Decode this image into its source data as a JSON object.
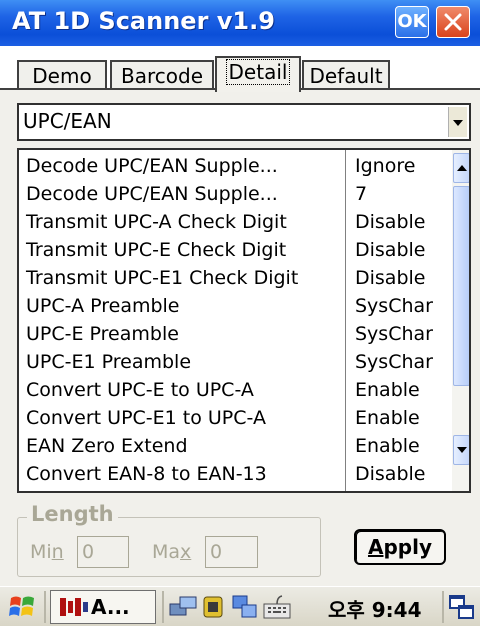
{
  "window": {
    "title": "AT 1D Scanner v1.9",
    "ok_label": "OK"
  },
  "tabs": [
    {
      "label": "Demo",
      "active": false
    },
    {
      "label": "Barcode",
      "active": false
    },
    {
      "label": "Detail",
      "active": true
    },
    {
      "label": "Default",
      "active": false
    }
  ],
  "symbology": {
    "selected": "UPC/EAN"
  },
  "settings": [
    {
      "name": "Decode UPC/EAN Supple...",
      "value": "Ignore"
    },
    {
      "name": "Decode UPC/EAN Supple...",
      "value": "7"
    },
    {
      "name": "Transmit UPC-A Check Digit",
      "value": "Disable"
    },
    {
      "name": "Transmit UPC-E Check Digit",
      "value": "Disable"
    },
    {
      "name": "Transmit UPC-E1 Check Digit",
      "value": "Disable"
    },
    {
      "name": "UPC-A Preamble",
      "value": "SysChar"
    },
    {
      "name": "UPC-E Preamble",
      "value": "SysChar"
    },
    {
      "name": "UPC-E1 Preamble",
      "value": "SysChar"
    },
    {
      "name": "Convert UPC-E to UPC-A",
      "value": "Enable"
    },
    {
      "name": "Convert UPC-E1 to UPC-A",
      "value": "Enable"
    },
    {
      "name": "EAN Zero Extend",
      "value": "Enable"
    },
    {
      "name": "Convert EAN-8 to EAN-13",
      "value": "Disable"
    }
  ],
  "length": {
    "group_label": "Length",
    "min_label": "Min",
    "min_value": "0",
    "max_label": "Max",
    "max_value": "0"
  },
  "apply_label": "Apply",
  "taskbar": {
    "task_label": "A...",
    "clock": "오후 9:44"
  },
  "colors": {
    "titlebar": "#1f64e6",
    "panel": "#f1f0eb",
    "disabled_text": "#a9a796"
  },
  "icons": [
    "start-flag-icon",
    "app-icon",
    "network-icon",
    "battery-icon",
    "sync-icon",
    "keyboard-icon",
    "windows-icon"
  ]
}
